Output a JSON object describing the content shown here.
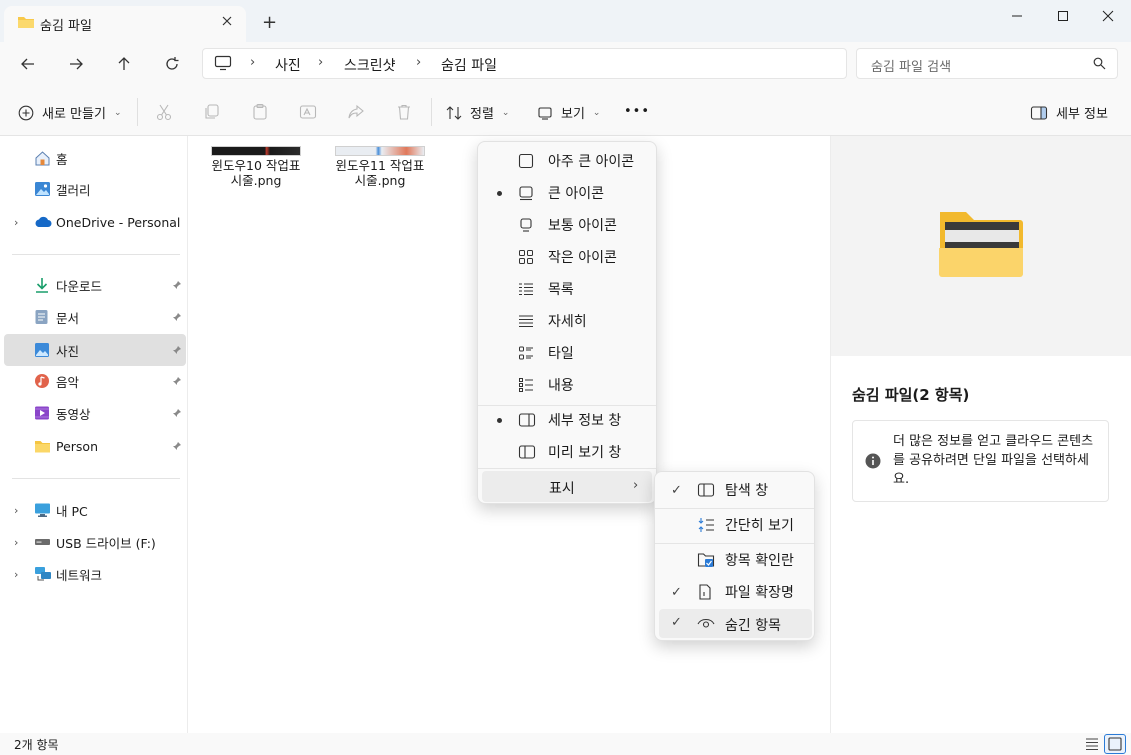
{
  "window": {
    "tab_title": "숨김 파일",
    "new_tab": "+",
    "minimize": "—",
    "maximize": "☐",
    "close": "✕"
  },
  "address": {
    "crumbs": [
      "사진",
      "스크린샷",
      "숨김 파일"
    ],
    "search_placeholder": "숨김 파일 검색"
  },
  "toolbar": {
    "new_label": "새로 만들기",
    "sort_label": "정렬",
    "view_label": "보기",
    "more_label": "•••",
    "details_label": "세부 정보"
  },
  "sidebar": {
    "items": [
      {
        "label": "홈",
        "icon": "home-icon"
      },
      {
        "label": "갤러리",
        "icon": "gallery-icon"
      },
      {
        "label": "OneDrive - Personal",
        "icon": "cloud-icon"
      },
      {
        "label": "다운로드",
        "icon": "download-icon"
      },
      {
        "label": "문서",
        "icon": "document-icon"
      },
      {
        "label": "사진",
        "icon": "pictures-icon"
      },
      {
        "label": "음악",
        "icon": "music-icon"
      },
      {
        "label": "동영상",
        "icon": "video-icon"
      },
      {
        "label": "Person",
        "icon": "folder-icon"
      },
      {
        "label": "내 PC",
        "icon": "pc-icon"
      },
      {
        "label": "USB 드라이브 (F:)",
        "icon": "usb-drive-icon"
      },
      {
        "label": "네트워크",
        "icon": "network-icon"
      }
    ]
  },
  "files": [
    {
      "name": "윈도우10 작업표시줄.png"
    },
    {
      "name": "윈도우11 작업표시줄.png"
    }
  ],
  "view_menu": {
    "items": [
      {
        "label": "아주 큰 아이콘",
        "selected": false
      },
      {
        "label": "큰 아이콘",
        "selected": true
      },
      {
        "label": "보통 아이콘",
        "selected": false
      },
      {
        "label": "작은 아이콘",
        "selected": false
      },
      {
        "label": "목록",
        "selected": false
      },
      {
        "label": "자세히",
        "selected": false
      },
      {
        "label": "타일",
        "selected": false
      },
      {
        "label": "내용",
        "selected": false
      }
    ],
    "pane_items": [
      {
        "label": "세부 정보 창",
        "selected": true
      },
      {
        "label": "미리 보기 창",
        "selected": false
      }
    ],
    "show_label": "표시"
  },
  "show_submenu": {
    "items": [
      {
        "label": "탐색 창",
        "checked": true
      },
      {
        "label": "간단히 보기",
        "checked": false
      },
      {
        "label": "항목 확인란",
        "checked": false
      },
      {
        "label": "파일 확장명",
        "checked": true
      },
      {
        "label": "숨긴 항목",
        "checked": true
      }
    ]
  },
  "details": {
    "title": "숨김 파일(2 항목)",
    "info": "더 많은 정보를 얻고 클라우드 콘텐츠를 공유하려면 단일 파일을 선택하세요."
  },
  "status": {
    "count": "2개 항목"
  }
}
